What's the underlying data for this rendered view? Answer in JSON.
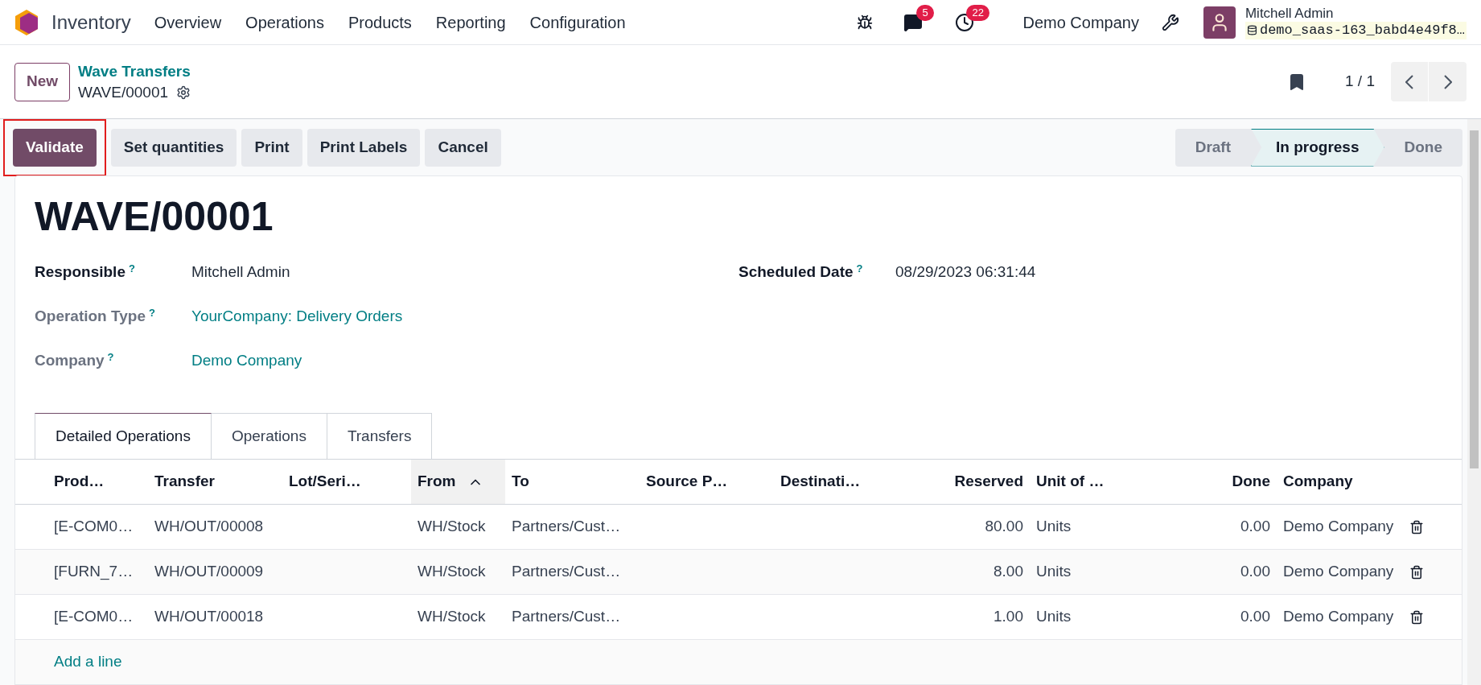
{
  "navbar": {
    "app_name": "Inventory",
    "menu": [
      "Overview",
      "Operations",
      "Products",
      "Reporting",
      "Configuration"
    ],
    "messages_badge": "5",
    "activities_badge": "22",
    "company": "Demo Company",
    "user_name": "Mitchell Admin",
    "database": "demo_saas-163_babd4e49f8…"
  },
  "control_panel": {
    "new_button": "New",
    "breadcrumb": "Wave Transfers",
    "record_name": "WAVE/00001",
    "pager": "1 / 1"
  },
  "actions": [
    {
      "label": "Validate",
      "primary": true,
      "highlighted": true
    },
    {
      "label": "Set quantities",
      "primary": false,
      "highlighted": false
    },
    {
      "label": "Print",
      "primary": false,
      "highlighted": false
    },
    {
      "label": "Print Labels",
      "primary": false,
      "highlighted": false
    },
    {
      "label": "Cancel",
      "primary": false,
      "highlighted": false
    }
  ],
  "status_bar": [
    {
      "label": "Draft",
      "selected": false
    },
    {
      "label": "In progress",
      "selected": true
    },
    {
      "label": "Done",
      "selected": false
    }
  ],
  "form": {
    "title": "WAVE/00001",
    "left_fields": [
      {
        "label": "Responsible",
        "help": "?",
        "value": "Mitchell Admin",
        "link": false,
        "bold_label": true
      },
      {
        "label": "Operation Type",
        "help": "?",
        "value": "YourCompany: Delivery Orders",
        "link": true,
        "bold_label": false
      },
      {
        "label": "Company",
        "help": "?",
        "value": "Demo Company",
        "link": true,
        "bold_label": false
      }
    ],
    "right_fields": [
      {
        "label": "Scheduled Date",
        "help": "?",
        "value": "08/29/2023 06:31:44",
        "link": false,
        "bold_label": true
      }
    ]
  },
  "tabs": [
    {
      "label": "Detailed Operations",
      "selected": true
    },
    {
      "label": "Operations",
      "selected": false
    },
    {
      "label": "Transfers",
      "selected": false
    }
  ],
  "table": {
    "columns": [
      {
        "label": "Prod…",
        "kind": "text",
        "sorted": false
      },
      {
        "label": "Transfer",
        "kind": "text",
        "sorted": false
      },
      {
        "label": "Lot/Seri…",
        "kind": "text",
        "sorted": false
      },
      {
        "label": "From",
        "kind": "text",
        "sorted": true
      },
      {
        "label": "To",
        "kind": "text",
        "sorted": false
      },
      {
        "label": "Source P…",
        "kind": "text",
        "sorted": false
      },
      {
        "label": "Destinati…",
        "kind": "text",
        "sorted": false
      },
      {
        "label": "Reserved",
        "kind": "number",
        "sorted": false
      },
      {
        "label": "Unit of …",
        "kind": "text",
        "sorted": false
      },
      {
        "label": "Done",
        "kind": "number",
        "sorted": false
      },
      {
        "label": "Company",
        "kind": "text",
        "sorted": false
      }
    ],
    "rows": [
      {
        "cells": [
          "[E-COM0…",
          "WH/OUT/00008",
          "",
          "WH/Stock",
          "Partners/Cust…",
          "",
          "",
          "80.00",
          "Units",
          "0.00",
          "Demo Company"
        ]
      },
      {
        "cells": [
          "[FURN_7…",
          "WH/OUT/00009",
          "",
          "WH/Stock",
          "Partners/Cust…",
          "",
          "",
          "8.00",
          "Units",
          "0.00",
          "Demo Company"
        ]
      },
      {
        "cells": [
          "[E-COM0…",
          "WH/OUT/00018",
          "",
          "WH/Stock",
          "Partners/Cust…",
          "",
          "",
          "1.00",
          "Units",
          "0.00",
          "Demo Company"
        ]
      }
    ],
    "add_line": "Add a line"
  }
}
